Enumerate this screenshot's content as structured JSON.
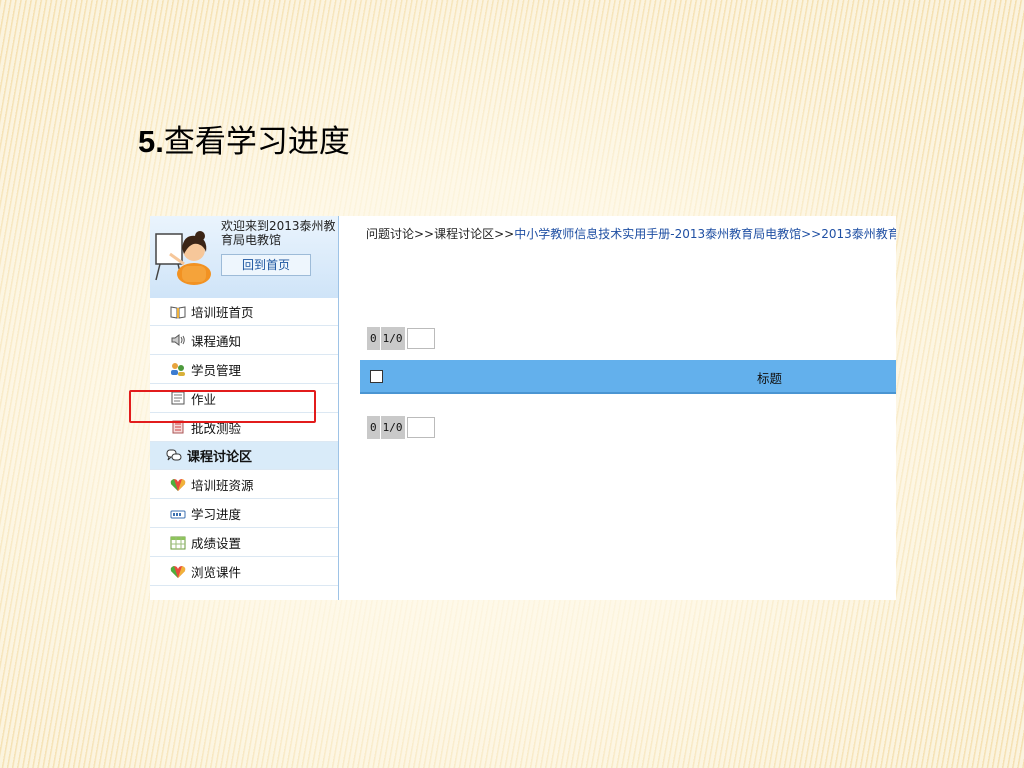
{
  "slide": {
    "number": "5.",
    "title": "查看学习进度"
  },
  "profile": {
    "welcome_line1": "欢迎来到2013泰州教",
    "welcome_line2": "育局电教馆",
    "home_button": "回到首页"
  },
  "menu": [
    {
      "label": "培训班首页",
      "icon": "book-icon"
    },
    {
      "label": "课程通知",
      "icon": "speaker-icon"
    },
    {
      "label": "学员管理",
      "icon": "users-icon"
    },
    {
      "label": "作业",
      "icon": "document-icon"
    },
    {
      "label": "批改测验",
      "icon": "grading-icon"
    },
    {
      "label": "课程讨论区",
      "icon": "chat-bubbles-icon",
      "active": true
    },
    {
      "label": "培训班资源",
      "icon": "resource-icon"
    },
    {
      "label": "学习进度",
      "icon": "progress-icon"
    },
    {
      "label": "成绩设置",
      "icon": "grid-icon"
    },
    {
      "label": "浏览课件",
      "icon": "resource-icon"
    }
  ],
  "breadcrumb": {
    "part1": "问题讨论>>课程讨论区>>",
    "part2": "中小学教师信息技术实用手册-2013泰州教育局电教馆",
    "part3": ">>2013泰州教育"
  },
  "pager_top": {
    "count": "0",
    "page": "1/0",
    "input_value": ""
  },
  "pager_bottom": {
    "count": "0",
    "page": "1/0",
    "input_value": ""
  },
  "table": {
    "header_title": "标题"
  },
  "colors": {
    "header_blue": "#63b0ec",
    "highlight_red": "#e21c1c",
    "sidebar_active": "#d9ebf9"
  }
}
